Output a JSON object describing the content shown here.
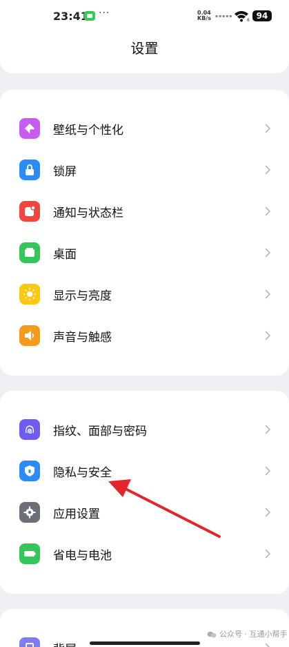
{
  "status_bar": {
    "time": "23:41",
    "dots": "···",
    "net_speed_value": "0.04",
    "net_speed_unit": "KB/s",
    "signal_indicator": "▪▪▪▪▪",
    "battery": "94"
  },
  "page": {
    "title": "设置"
  },
  "groups": [
    {
      "items": [
        {
          "label": "壁纸与个性化",
          "icon": "palette-icon",
          "color": "#c65cf0"
        },
        {
          "label": "锁屏",
          "icon": "lock-icon",
          "color": "#2b8cf7"
        },
        {
          "label": "通知与状态栏",
          "icon": "notification-icon",
          "color": "#f1453d"
        },
        {
          "label": "桌面",
          "icon": "home-screen-icon",
          "color": "#35c55a"
        },
        {
          "label": "显示与亮度",
          "icon": "sun-icon",
          "color": "#f9c80f"
        },
        {
          "label": "声音与触感",
          "icon": "speaker-icon",
          "color": "#f59a1b"
        }
      ]
    },
    {
      "items": [
        {
          "label": "指纹、面部与密码",
          "icon": "fingerprint-icon",
          "color": "#6e5cf0"
        },
        {
          "label": "隐私与安全",
          "icon": "shield-icon",
          "color": "#2b8cf7"
        },
        {
          "label": "应用设置",
          "icon": "gear-icon",
          "color": "#6b6f76"
        },
        {
          "label": "省电与电池",
          "icon": "battery-icon",
          "color": "#35c55a"
        }
      ]
    },
    {
      "items": [
        {
          "label": "背屏",
          "icon": "rear-screen-icon",
          "color": "#7e7cf3"
        }
      ]
    }
  ],
  "watermark": "公众号 · 互通小帮手",
  "annotation_color": "#e3262b"
}
